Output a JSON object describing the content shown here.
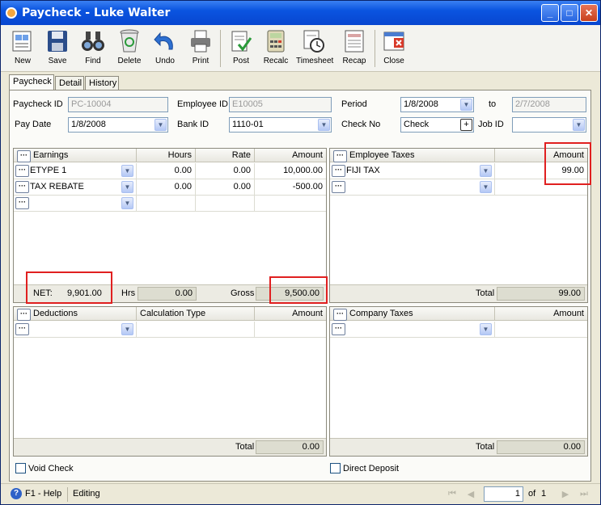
{
  "window": {
    "title": "Paycheck - Luke  Walter"
  },
  "toolbar": [
    {
      "label": "New",
      "icon": "new-document-icon"
    },
    {
      "label": "Save",
      "icon": "floppy-save-icon"
    },
    {
      "label": "Find",
      "icon": "binoculars-find-icon"
    },
    {
      "label": "Delete",
      "icon": "recycle-bin-delete-icon"
    },
    {
      "label": "Undo",
      "icon": "undo-arrow-icon"
    },
    {
      "label": "Print",
      "icon": "printer-icon"
    },
    {
      "label": "Post",
      "icon": "post-check-icon"
    },
    {
      "label": "Recalc",
      "icon": "calculator-icon"
    },
    {
      "label": "Timesheet",
      "icon": "timesheet-clock-icon"
    },
    {
      "label": "Recap",
      "icon": "recap-document-icon"
    },
    {
      "label": "Close",
      "icon": "close-window-icon"
    }
  ],
  "tabs": [
    {
      "label": "Paycheck",
      "active": true
    },
    {
      "label": "Detail",
      "active": false
    },
    {
      "label": "History",
      "active": false
    }
  ],
  "form": {
    "paycheck_id_label": "Paycheck ID",
    "paycheck_id": "PC-10004",
    "employee_id_label": "Employee ID",
    "employee_id": "E10005",
    "period_label": "Period",
    "period_from": "1/8/2008",
    "to_label": "to",
    "period_to": "2/7/2008",
    "pay_date_label": "Pay Date",
    "pay_date": "1/8/2008",
    "bank_id_label": "Bank ID",
    "bank_id": "1110-01",
    "check_no_label": "Check No",
    "check_no": "Check",
    "job_id_label": "Job ID",
    "job_id": ""
  },
  "earnings": {
    "columns": [
      "Earnings",
      "Hours",
      "Rate",
      "Amount"
    ],
    "rows": [
      {
        "name": "ETYPE 1",
        "hours": "0.00",
        "rate": "0.00",
        "amount": "10,000.00"
      },
      {
        "name": "TAX REBATE",
        "hours": "0.00",
        "rate": "0.00",
        "amount": "-500.00"
      },
      {
        "name": "",
        "hours": "",
        "rate": "",
        "amount": ""
      }
    ],
    "net_label": "NET:",
    "net": "9,901.00",
    "hrs_label": "Hrs",
    "hrs": "0.00",
    "gross_label": "Gross",
    "gross": "9,500.00"
  },
  "employee_taxes": {
    "columns": [
      "Employee Taxes",
      "Amount"
    ],
    "rows": [
      {
        "name": "FIJI TAX",
        "amount": "99.00"
      },
      {
        "name": "",
        "amount": ""
      }
    ],
    "total_label": "Total",
    "total": "99.00"
  },
  "deductions": {
    "columns": [
      "Deductions",
      "Calculation Type",
      "Amount"
    ],
    "rows": [
      {
        "name": "",
        "calc": "",
        "amount": ""
      }
    ],
    "total_label": "Total",
    "total": "0.00"
  },
  "company_taxes": {
    "columns": [
      "Company Taxes",
      "Amount"
    ],
    "rows": [
      {
        "name": "",
        "amount": ""
      }
    ],
    "total_label": "Total",
    "total": "0.00"
  },
  "options": {
    "void_check": "Void Check",
    "direct_deposit": "Direct Deposit"
  },
  "status": {
    "help": "F1 - Help",
    "mode": "Editing",
    "page": "1",
    "of_label": "of",
    "page_count": "1"
  },
  "colors": {
    "titlebar": "#0a54e0",
    "highlight": "#e02020",
    "window_bg": "#ece9d8"
  }
}
